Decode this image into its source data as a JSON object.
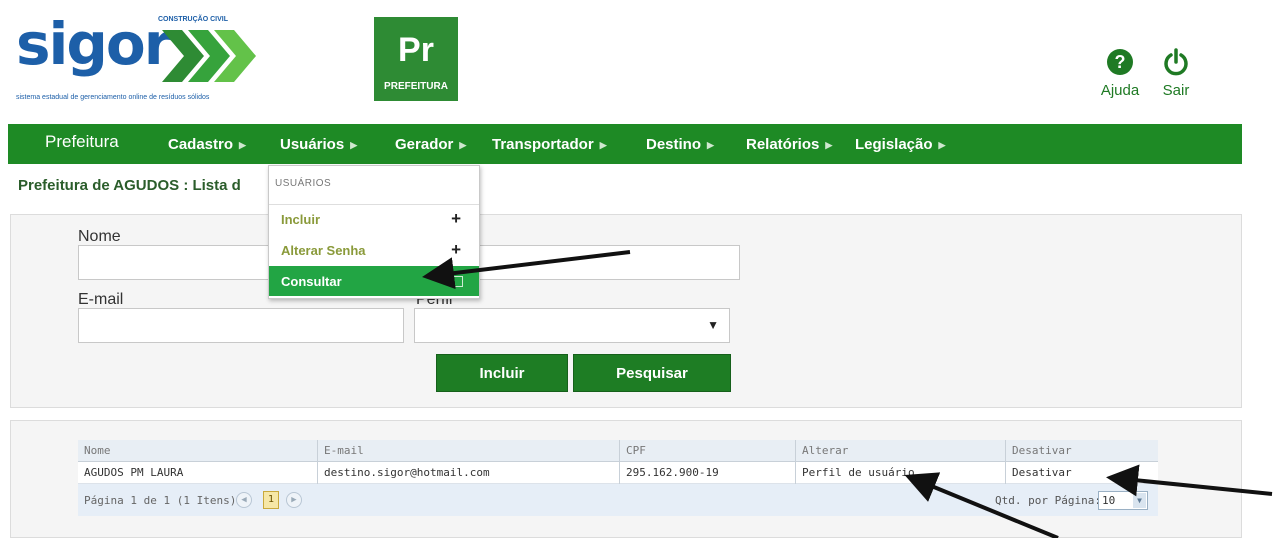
{
  "header": {
    "logo_word": "sigor",
    "logo_tag": "CONSTRUÇÃO CIVIL",
    "logo_subtitle": "sistema estadual de gerenciamento online de resíduos sólidos",
    "pr_badge": "Pr",
    "pr_label": "PREFEITURA",
    "help_label": "Ajuda",
    "quit_label": "Sair"
  },
  "nav": {
    "home": "Prefeitura",
    "items": [
      "Cadastro",
      "Usuários",
      "Gerador",
      "Transportador",
      "Destino",
      "Relatórios",
      "Legislação"
    ]
  },
  "breadcrumb": "Prefeitura de AGUDOS : Lista d",
  "filters": {
    "nome_label": "Nome",
    "email_label": "E-mail",
    "perfil_label": "Perfil",
    "nome_value": "",
    "cpf_value": "",
    "email_value": "",
    "perfil_value": "",
    "incluir_button": "Incluir",
    "pesquisar_button": "Pesquisar"
  },
  "menu": {
    "title": "USUÁRIOS",
    "items": [
      "Incluir",
      "Alterar Senha",
      "Consultar"
    ]
  },
  "grid": {
    "columns": [
      "Nome",
      "E-mail",
      "CPF",
      "Alterar",
      "Desativar"
    ],
    "rows": [
      [
        "AGUDOS PM LAURA",
        "destino.sigor@hotmail.com",
        "295.162.900-19",
        "Perfil de usuário",
        "Desativar"
      ]
    ],
    "pager_text": "Página 1 de 1 (1 Itens).",
    "current_page": "1",
    "page_size_label": "Qtd. por Página:",
    "page_size": "10"
  },
  "colors": {
    "nav_green": "#1e8a25",
    "brand_blue": "#1d5fa8",
    "menu_active": "#22a544"
  }
}
